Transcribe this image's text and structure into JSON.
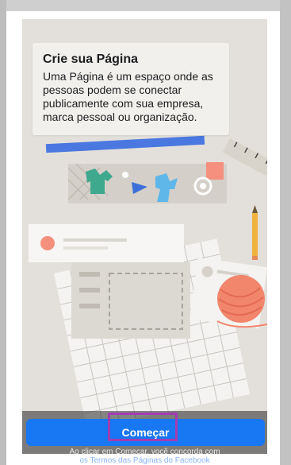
{
  "dialog": {
    "close_label": "×",
    "title": "Crie sua Página",
    "description": "Uma Página é um espaço onde as pessoas podem se conectar publicamente com sua empresa, marca pessoal ou organização.",
    "cta_label": "Começar",
    "terms_prefix": "Ao clicar em Começar, você concorda com",
    "terms_link": "os Termos das Páginas do Facebook"
  },
  "icons": {
    "close": "close-icon",
    "illustration": "page-illustration"
  },
  "colors": {
    "primary": "#1877f2",
    "highlight": "#a23db0",
    "illustration_bg": "#e3e0db"
  }
}
